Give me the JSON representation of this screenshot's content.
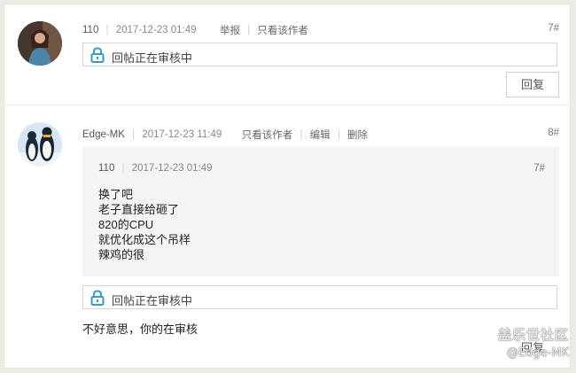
{
  "posts": [
    {
      "username": "110",
      "datetime": "2017-12-23 01:49",
      "actions": [
        "举报",
        "只看该作者"
      ],
      "floor": "7#",
      "review_notice": "回帖正在审核中",
      "reply_label": "回复"
    },
    {
      "username": "Edge-MK",
      "datetime": "2017-12-23 11:49",
      "actions": [
        "只看该作者",
        "编辑",
        "删除"
      ],
      "floor": "8#",
      "quote": {
        "username": "110",
        "datetime": "2017-12-23 01:49",
        "floor": "7#",
        "lines": [
          "换了吧",
          "老子直接给砸了",
          "820的CPU",
          "就优化成这个吊样",
          "辣鸡的很"
        ]
      },
      "review_notice": "回帖正在审核中",
      "comment": "不好意思，你的在审核",
      "hidden_label": "回复"
    }
  ],
  "watermark": {
    "title": "盖乐世社区",
    "user": "@Edge-MK"
  },
  "colors": {
    "lock_icon": "#3a9bbf",
    "page_bg": "#ecece4"
  }
}
